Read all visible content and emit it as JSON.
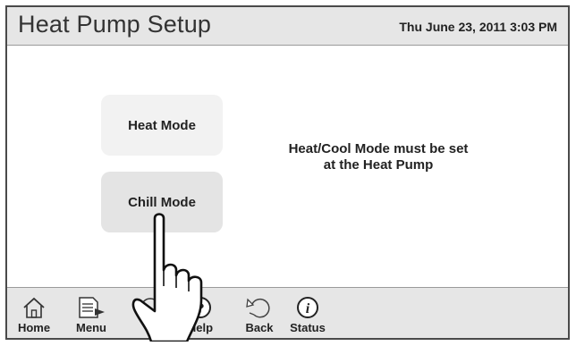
{
  "header": {
    "title": "Heat Pump Setup",
    "datetime": "Thu June 23, 2011  3:03 PM"
  },
  "main": {
    "heat_mode_label": "Heat Mode",
    "chill_mode_label": "Chill Mode",
    "notice_line1": "Heat/Cool Mode must be set",
    "notice_line2": "at the Heat Pump"
  },
  "footer": {
    "items": [
      {
        "label": "Home",
        "icon": "home-icon"
      },
      {
        "label": "Menu",
        "icon": "menu-icon"
      },
      {
        "label": "uch",
        "icon": "touch-icon"
      },
      {
        "label": "Help",
        "icon": "help-icon"
      },
      {
        "label": "Back",
        "icon": "back-icon"
      },
      {
        "label": "Status",
        "icon": "status-icon"
      }
    ]
  },
  "overlay": {
    "icon": "pointing-hand-icon"
  }
}
